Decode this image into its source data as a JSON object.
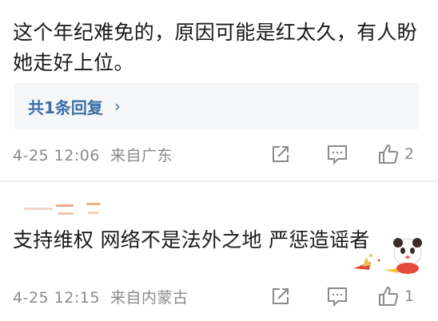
{
  "comment1": {
    "text": "这个年纪难免的，原因可能是红太久，有人盼她走好上位。",
    "reply_label": "共1条回复",
    "reply_chevron": "›",
    "meta": "4-25 12:06  来自广东",
    "like_count": "2"
  },
  "comment2": {
    "text": "支持维权 网络不是法外之地 严惩造谣者",
    "meta": "4-25 12:15  来自内蒙古",
    "like_count": "1"
  },
  "icons": [
    "share-icon",
    "comment-icon",
    "like-icon",
    "sticker-icon"
  ],
  "colors": {
    "text": "#1a1a1a",
    "meta": "#8a8a8a",
    "link": "#3b6fa6",
    "reply_bg": "#f5f6f8",
    "icon": "#8a8a8a"
  }
}
